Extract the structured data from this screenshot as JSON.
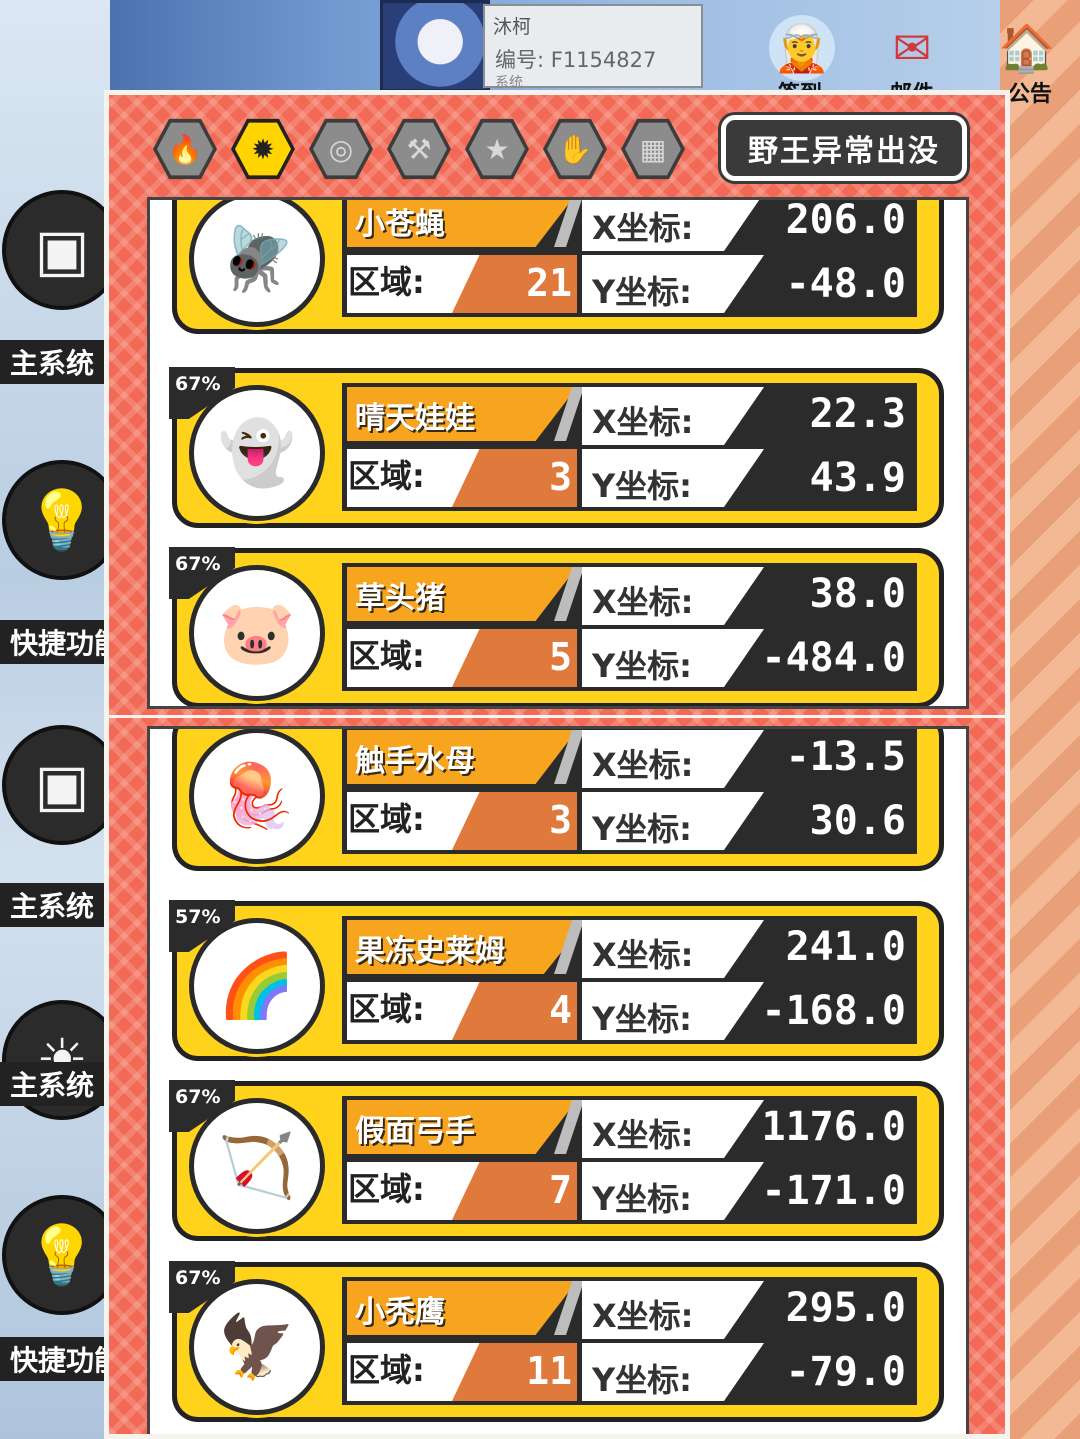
{
  "player": {
    "name": "沐柯",
    "id_label": "编号: F1154827",
    "system": "系统"
  },
  "top_icons": [
    {
      "icon": "character-icon",
      "label": "签到"
    },
    {
      "icon": "mail-icon",
      "label": "邮件"
    },
    {
      "icon": "notice-board-icon",
      "label": "公告"
    }
  ],
  "side_buttons": [
    {
      "icon": "window-icon",
      "label": "主系统"
    },
    {
      "icon": "lightbulb-icon",
      "label": "快捷功能"
    },
    {
      "icon": "window-icon",
      "label": "主系统"
    },
    {
      "icon": "sun-icon",
      "label": "主系统"
    },
    {
      "icon": "lightbulb-icon",
      "label": "快捷功能"
    }
  ],
  "tabs": [
    {
      "icon": "flame-icon",
      "glyph": "🔥",
      "active": false
    },
    {
      "icon": "flame-star-icon",
      "glyph": "✹",
      "active": true
    },
    {
      "icon": "coins-icon",
      "glyph": "◎",
      "active": false
    },
    {
      "icon": "hammer-icon",
      "glyph": "⚒",
      "active": false
    },
    {
      "icon": "star-badge-icon",
      "glyph": "★",
      "active": false
    },
    {
      "icon": "hand-icon",
      "glyph": "✋",
      "active": false
    },
    {
      "icon": "grid-icon",
      "glyph": "▦",
      "active": false
    }
  ],
  "event_button": "野王异常出没",
  "labels": {
    "zone": "区域:",
    "x": "X坐标:",
    "y": "Y坐标:"
  },
  "panel1_monsters": [
    {
      "percent": "",
      "name": "小苍蝇",
      "zone": "21",
      "x": "206.0",
      "y": "-48.0",
      "avatar": "🪰"
    },
    {
      "percent": "67%",
      "name": "晴天娃娃",
      "zone": "3",
      "x": "22.3",
      "y": "43.9",
      "avatar": "👻"
    },
    {
      "percent": "67%",
      "name": "草头猪",
      "zone": "5",
      "x": "38.0",
      "y": "-484.0",
      "avatar": "🐷"
    }
  ],
  "panel2_monsters": [
    {
      "percent": "",
      "name": "触手水母",
      "zone": "3",
      "x": "-13.5",
      "y": "30.6",
      "avatar": "🪼"
    },
    {
      "percent": "57%",
      "name": "果冻史莱姆",
      "zone": "4",
      "x": "241.0",
      "y": "-168.0",
      "avatar": "🌈"
    },
    {
      "percent": "67%",
      "name": "假面弓手",
      "zone": "7",
      "x": "1176.0",
      "y": "-171.0",
      "avatar": "🏹"
    },
    {
      "percent": "67%",
      "name": "小秃鹰",
      "zone": "11",
      "x": "295.0",
      "y": "-79.0",
      "avatar": "🦅"
    }
  ]
}
